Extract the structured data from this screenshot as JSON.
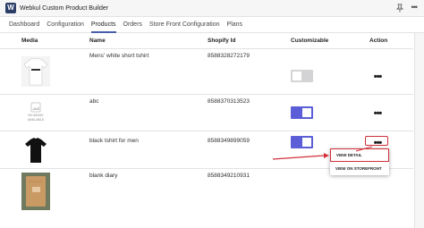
{
  "app": {
    "title": "Webkul Custom Product Builder",
    "logo_letter": "W",
    "pin_icon": "pin-icon",
    "more_icon": "more-horizontal-icon"
  },
  "nav": {
    "tabs": [
      {
        "label": "Dashboard"
      },
      {
        "label": "Configuration"
      },
      {
        "label": "Products",
        "active": true
      },
      {
        "label": "Orders"
      },
      {
        "label": "Store Front Configuration"
      },
      {
        "label": "Plans"
      }
    ]
  },
  "table": {
    "headers": {
      "media": "Media",
      "name": "Name",
      "shopify_id": "Shopify Id",
      "customizable": "Customizable",
      "action": "Action"
    },
    "rows": [
      {
        "name": "Mens' white short tshirt",
        "shopify_id": "8588328272179",
        "customizable": false,
        "media": "white-tshirt-image",
        "media_caption": ""
      },
      {
        "name": "abc",
        "shopify_id": "8588370313523",
        "customizable": true,
        "media": "no-image-placeholder",
        "media_caption": "NO IMAGE AVAILABLE"
      },
      {
        "name": "black tshirt for men",
        "shopify_id": "8588349899059",
        "customizable": true,
        "media": "black-tshirt-image",
        "media_caption": ""
      },
      {
        "name": "blank diary",
        "shopify_id": "8588349210931",
        "customizable": false,
        "media": "blank-diary-image",
        "media_caption": ""
      }
    ],
    "action_label": "•••"
  },
  "dropdown": {
    "items": [
      {
        "label": "VIEW DETAIL"
      },
      {
        "label": "VIEW ON STOREFRONT"
      }
    ]
  },
  "colors": {
    "accent": "#5b5ed6",
    "annotation": "#d2303a",
    "toggle_off": "#d3d3d5"
  }
}
